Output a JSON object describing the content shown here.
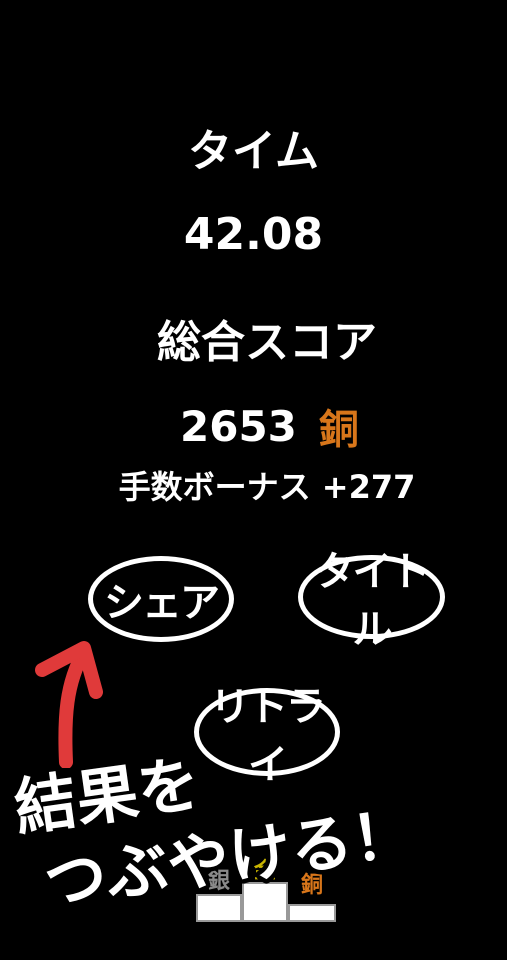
{
  "result": {
    "time_label": "タイム",
    "time_value": "42.08",
    "score_label": "総合スコア",
    "score_value": "2653",
    "medal": "銅",
    "bonus_label": "手数ボーナス",
    "bonus_value": "+277"
  },
  "buttons": {
    "share": "シェア",
    "title": "タイトル",
    "retry": "リトライ"
  },
  "promo": {
    "line1": "結果を",
    "line2": "つぶやける！"
  },
  "podium": {
    "silver": "銀",
    "gold": "金",
    "bronze": "銅"
  },
  "colors": {
    "background": "#000000",
    "text": "#ffffff",
    "bronze": "#d8761a",
    "gold": "#c8b400",
    "silver": "#8a8a8a",
    "arrow": "#e03a3a"
  }
}
